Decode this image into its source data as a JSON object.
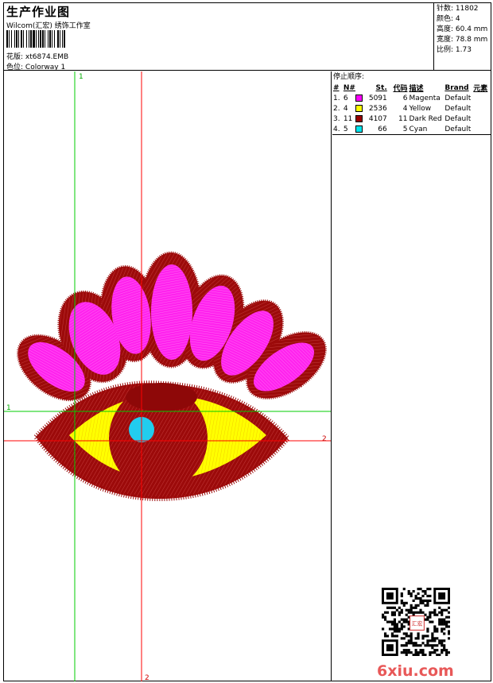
{
  "header": {
    "title": "生产作业图",
    "subtitle": "Wilcom(汇宏) 绣饰工作室",
    "pattern_label": "花版:",
    "pattern_value": "xt6874.EMB",
    "colorway_label": "色位:",
    "colorway_value": "Colorway 1"
  },
  "stats": {
    "stitches": "针数: 11802",
    "colors": "颜色: 4",
    "height": "高度: 60.4 mm",
    "width": "宽度: 78.8 mm",
    "scale": "比例: 1.73"
  },
  "stop_sequence": {
    "title": "停止顺序:",
    "headers": {
      "no": "#",
      "n": "N#",
      "st": "St.",
      "code": "代码",
      "desc": "描述",
      "brand": "Brand",
      "element": "元素"
    },
    "rows": [
      {
        "no": "1.",
        "n": "6",
        "color": "#ff00ff",
        "st": "5091",
        "code": "6",
        "desc": "Magenta",
        "brand": "Default"
      },
      {
        "no": "2.",
        "n": "4",
        "color": "#ffff00",
        "st": "2536",
        "code": "4",
        "desc": "Yellow",
        "brand": "Default"
      },
      {
        "no": "3.",
        "n": "11",
        "color": "#990000",
        "st": "4107",
        "code": "11",
        "desc": "Dark Red",
        "brand": "Default"
      },
      {
        "no": "4.",
        "n": "5",
        "color": "#00e5ee",
        "st": "66",
        "code": "5",
        "desc": "Cyan",
        "brand": "Default"
      }
    ]
  },
  "axes": {
    "v1": "1",
    "h1": "1",
    "h2": "2",
    "v2": "2"
  },
  "colors": {
    "magenta": "#ff22ee",
    "yellow": "#ffff00",
    "dark_red": "#9c0a0a",
    "cyan": "#22ccee",
    "green_line": "#00cc00",
    "red_line": "#ff0000"
  },
  "watermark": "6xiu.com",
  "seal_text": "汇宏"
}
